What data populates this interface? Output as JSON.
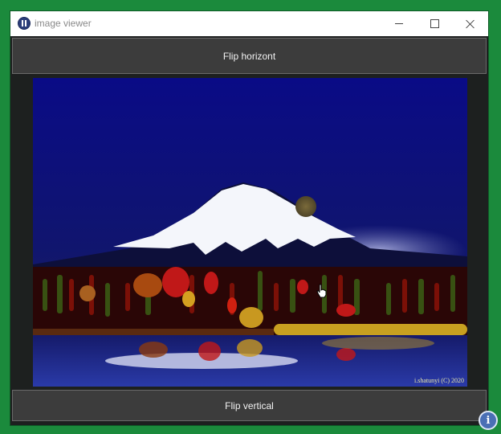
{
  "window": {
    "title": "image viewer",
    "controls": {
      "minimize": "minimize",
      "maximize": "maximize",
      "close": "close"
    }
  },
  "buttons": {
    "flip_horizontal": "Flip horizont",
    "flip_vertical": "Flip vertical"
  },
  "image": {
    "credit": "i.shatunyi (C) 2020",
    "subject": "mountain-lake-night-painting"
  },
  "colors": {
    "background": "#1b8a3c",
    "button": "#3c3c3c",
    "sky": "#0b0d8a"
  },
  "icons": {
    "app": "app-logo-icon",
    "info": "info-icon",
    "cursor": "hand-pointer-icon"
  }
}
